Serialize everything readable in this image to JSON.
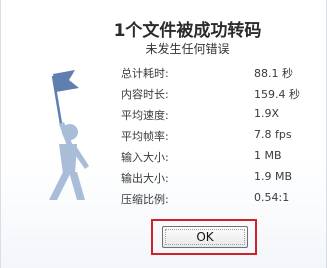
{
  "dialog": {
    "title": "1个文件被成功转码",
    "subtitle": "未发生任何错误"
  },
  "stats": [
    {
      "label": "总计耗时:",
      "value": "88.1 秒"
    },
    {
      "label": "内容时长:",
      "value": "159.4 秒"
    },
    {
      "label": "平均速度:",
      "value": "1.9X"
    },
    {
      "label": "平均帧率:",
      "value": "7.8 fps"
    },
    {
      "label": "输入大小:",
      "value": "1 MB"
    },
    {
      "label": "输出大小:",
      "value": "1.9 MB"
    },
    {
      "label": "压缩比例:",
      "value": "0.54:1"
    }
  ],
  "ok_button": {
    "label": "OK"
  },
  "icons": {
    "figure": "person-with-flag-icon"
  },
  "colors": {
    "figure": "#a9bcd8",
    "flag": "#5f7fb1",
    "highlight": "#d0202a"
  }
}
